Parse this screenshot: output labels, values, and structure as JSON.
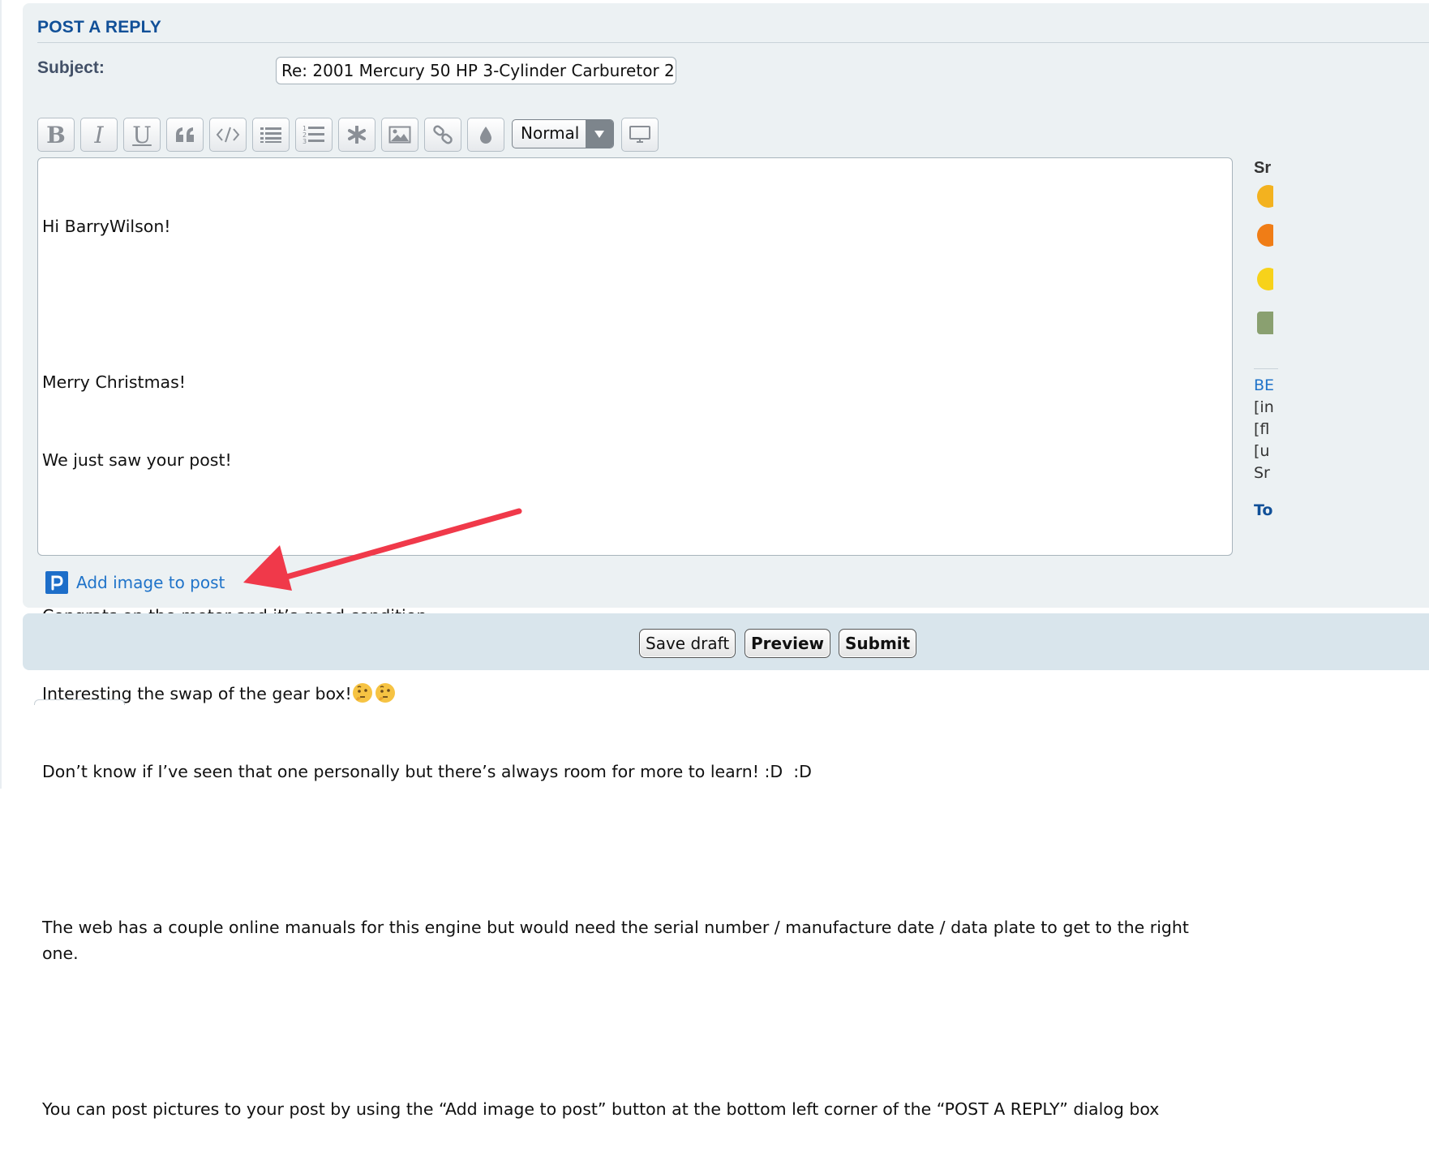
{
  "panel": {
    "title": "POST A REPLY"
  },
  "subject": {
    "label": "Subject:",
    "value": "Re: 2001 Mercury 50 HP 3-Cylinder Carburetor 2"
  },
  "toolbar": {
    "buttons": [
      {
        "name": "bold-button",
        "icon": "bold-letter-B"
      },
      {
        "name": "italic-button",
        "icon": "italic-letter-I"
      },
      {
        "name": "underline-button",
        "icon": "underline-letter-U"
      },
      {
        "name": "quote-button",
        "icon": "quote-icon"
      },
      {
        "name": "code-button",
        "icon": "code-icon"
      },
      {
        "name": "list-button",
        "icon": "list-icon"
      },
      {
        "name": "ordered-list-button",
        "icon": "ordered-list-icon"
      },
      {
        "name": "list-item-button",
        "icon": "asterisk-icon"
      },
      {
        "name": "image-button",
        "icon": "image-icon"
      },
      {
        "name": "link-button",
        "icon": "link-icon"
      },
      {
        "name": "color-button",
        "icon": "droplet-icon"
      },
      {
        "name": "preview-toggle-button",
        "icon": "monitor-icon"
      }
    ],
    "bold_label": "B",
    "italic_label": "I",
    "underline_label": "U",
    "font_size_selected": "Normal"
  },
  "editor": {
    "lines": [
      "Hi BarryWilson!",
      "",
      "Merry Christmas!",
      "We just saw your post!",
      "",
      "Congrats on the motor and it’s good condition.",
      "Interesting the swap of the gear box!",
      "Don’t know if I’ve seen that one personally but there’s always room for more to learn! :D  :D",
      "",
      "The web has a couple online manuals for this engine but would need the serial number / manufacture date / data plate to get to the right one.",
      "",
      "You can post pictures to your post by using the “Add image to post” button at the bottom left corner of the “POST A REPLY” dialog box"
    ],
    "inline_emoji": [
      "thinking-face-emoji",
      "thinking-face-emoji"
    ]
  },
  "add_image": {
    "label": "Add image to post",
    "icon": "postimage-p-icon"
  },
  "annotation": {
    "type": "red-arrow",
    "color": "#f0394a"
  },
  "sidebar": {
    "title_fragment": "Sr",
    "smilies": [
      "laughing-smiley",
      "evil-smiley",
      "question-smiley",
      "counter-smiley"
    ],
    "code_fragments": [
      "BE",
      "[in",
      "[fl",
      "[u",
      "Sr"
    ],
    "footer_fragment": "To"
  },
  "actions": {
    "save_draft": "Save draft",
    "preview": "Preview",
    "submit": "Submit"
  },
  "colors": {
    "panel_bg": "#ecf1f3",
    "title_blue": "#115098",
    "link_blue": "#1f73c9",
    "button_bar_bg": "#d9e5ec"
  }
}
